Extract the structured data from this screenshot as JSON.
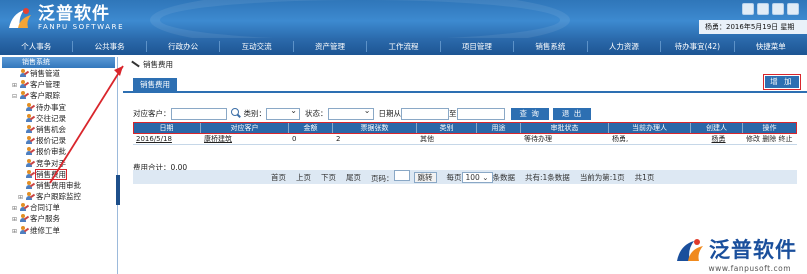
{
  "brand": {
    "name_cn": "泛普软件",
    "name_en": "FANPU SOFTWARE"
  },
  "user": {
    "line": "杨勇：2016年5月19日 星期"
  },
  "nav": [
    "个人事务",
    "公共事务",
    "行政办公",
    "互动交流",
    "资产管理",
    "工作流程",
    "项目管理",
    "销售系统",
    "人力资源",
    "待办事宜(42)",
    "快捷菜单"
  ],
  "sidebar": {
    "title": "销售系统",
    "items": [
      {
        "label": "销售管道",
        "tw": "",
        "lvl": 1
      },
      {
        "label": "客户管理",
        "tw": "⊞",
        "lvl": 1
      },
      {
        "label": "客户跟踪",
        "tw": "⊟",
        "lvl": 1
      },
      {
        "label": "待办事宜",
        "tw": "",
        "lvl": 2
      },
      {
        "label": "交往记录",
        "tw": "",
        "lvl": 2
      },
      {
        "label": "销售机会",
        "tw": "",
        "lvl": 2
      },
      {
        "label": "报价记录",
        "tw": "",
        "lvl": 2
      },
      {
        "label": "报价审批",
        "tw": "",
        "lvl": 2
      },
      {
        "label": "竞争对手",
        "tw": "",
        "lvl": 2
      },
      {
        "label": "销售费用",
        "tw": "",
        "lvl": 2,
        "selected": true
      },
      {
        "label": "销售费用审批",
        "tw": "",
        "lvl": 2
      },
      {
        "label": "客户跟踪监控",
        "tw": "⊞",
        "lvl": 2
      },
      {
        "label": "合同订单",
        "tw": "⊞",
        "lvl": 1
      },
      {
        "label": "客户服务",
        "tw": "⊞",
        "lvl": 1
      },
      {
        "label": "维修工单",
        "tw": "⊞",
        "lvl": 1
      }
    ]
  },
  "main": {
    "breadcrumb": "销售费用",
    "tab": "销售费用",
    "add_label": "增 加",
    "filters": {
      "customer_label": "对应客户：",
      "type_label": "类别：",
      "status_label": "状态：",
      "date_from_label": "日期从",
      "date_to_label": "至",
      "query_label": "查 询",
      "exit_label": "退 出"
    },
    "columns": [
      "日期",
      "对应客户",
      "金额",
      "票据张数",
      "类别",
      "用途",
      "审批状态",
      "当前办理人",
      "创建人",
      "操作"
    ],
    "rows": [
      {
        "date": "2016/5/18",
        "customer": "康桥建筑",
        "amount": "0",
        "tickets": "2",
        "type": "其他",
        "purpose": "",
        "status": "等待办理",
        "handler": "杨勇,",
        "creator": "杨勇",
        "ops": "修改 删除 终止"
      }
    ],
    "total": "费用合计：0.00",
    "pager": {
      "first": "首页",
      "prev": "上页",
      "next": "下页",
      "last": "尾页",
      "page_label": "页码：",
      "jump": "跳转",
      "per_page_label": "每页",
      "per_page": "100",
      "per_page_suffix": "条数据",
      "total_records": "共有:1条数据",
      "current": "当前为第:1页",
      "total_pages": "共1页"
    }
  },
  "watermark": {
    "name_cn": "泛普软件",
    "url": "www.fanpusoft.com"
  },
  "colors": {
    "header": "#2f76b9",
    "nav": "#1d5593",
    "grid_head": "#2a67a8",
    "highlight": "#d9262c"
  }
}
